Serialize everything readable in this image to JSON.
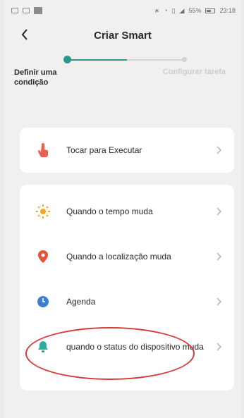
{
  "statusbar": {
    "battery": "55%",
    "time": "23:18"
  },
  "header": {
    "title": "Criar Smart"
  },
  "stepper": {
    "step1": "Definir uma condição",
    "step2": "Configurar tarefa"
  },
  "tap_card": {
    "label": "Tocar para Executar"
  },
  "conditions": [
    {
      "label": "Quando o tempo muda",
      "icon": "sun-icon"
    },
    {
      "label": "Quando a localização muda",
      "icon": "location-pin-icon"
    },
    {
      "label": "Agenda",
      "icon": "clock-icon"
    },
    {
      "label": "quando o status do dispositivo muda",
      "icon": "device-bell-icon"
    }
  ],
  "colors": {
    "accent": "#2a9a8c",
    "tap_icon": "#e8604f",
    "sun": "#f6a623",
    "pin": "#e8503a",
    "clock": "#3a7fd0",
    "device": "#2ab09a",
    "highlight": "#d63a3a"
  }
}
